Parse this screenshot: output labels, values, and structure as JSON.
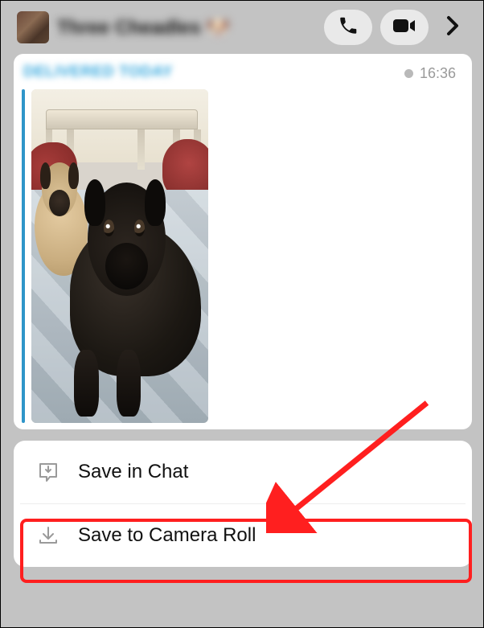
{
  "header": {
    "contact_name": "Three Cheadles 🐶"
  },
  "message": {
    "sender": "DELIVERED TODAY",
    "timestamp": "16:36"
  },
  "menu": {
    "save_in_chat": "Save in Chat",
    "save_camera_roll": "Save to Camera Roll"
  },
  "icons": {
    "phone": "phone-icon",
    "video": "video-icon",
    "chevron": "chevron-right-icon",
    "chat_save": "chat-download-icon",
    "download": "download-tray-icon"
  }
}
